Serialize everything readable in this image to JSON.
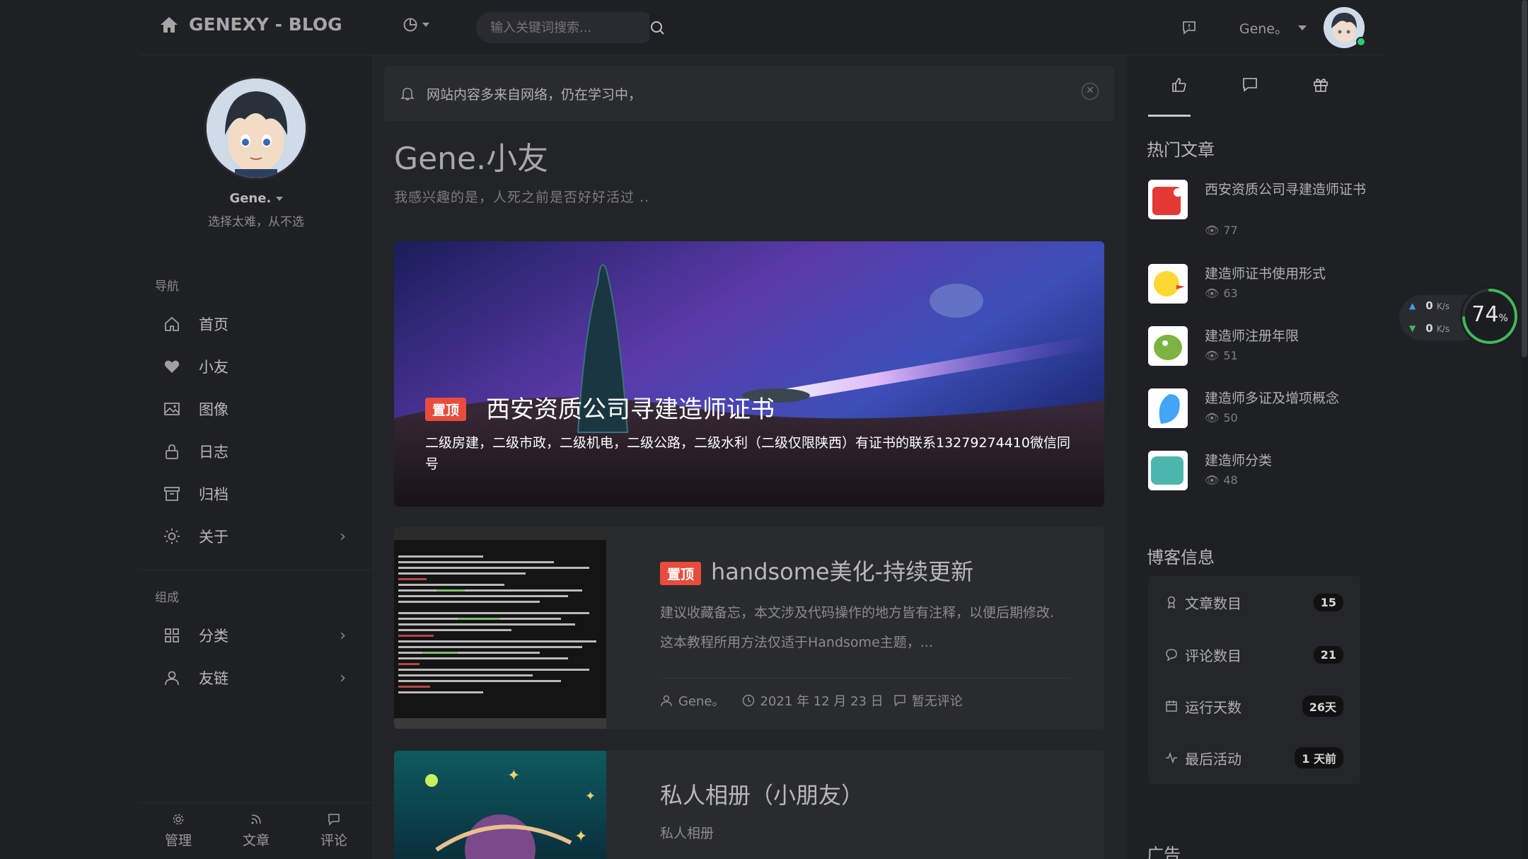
{
  "brand": {
    "title": "GENEXY - BLOG"
  },
  "search": {
    "placeholder": "输入关键词搜索..."
  },
  "user": {
    "name": "Gene。"
  },
  "profile": {
    "name": "Gene.",
    "bio": "选择太难，从不选"
  },
  "nav": {
    "section1": "导航",
    "items": [
      {
        "label": "首页",
        "icon": "home-icon"
      },
      {
        "label": "小友",
        "icon": "heart-icon"
      },
      {
        "label": "图像",
        "icon": "image-icon"
      },
      {
        "label": "日志",
        "icon": "lock-icon"
      },
      {
        "label": "归档",
        "icon": "archive-icon"
      },
      {
        "label": "关于",
        "icon": "sun-icon"
      }
    ],
    "section2": "组成",
    "items2": [
      {
        "label": "分类",
        "icon": "grid-icon"
      },
      {
        "label": "友链",
        "icon": "user-icon"
      }
    ]
  },
  "bottom": {
    "manage": "管理",
    "articles": "文章",
    "comments": "评论"
  },
  "notice": {
    "text": "网站内容多来自网络，仍在学习中，"
  },
  "headline": {
    "title": "Gene.小友",
    "subtitle": "我感兴趣的是，人死之前是否好好活过 .."
  },
  "hero": {
    "tag": "置顶",
    "title": "西安资质公司寻建造师证书",
    "desc": "二级房建，二级市政，二级机电，二级公路，二级水利（二级仅限陕西）有证书的联系13279274410微信同号"
  },
  "posts": [
    {
      "tag": "置顶",
      "title": "handsome美化-持续更新",
      "desc": "建议收藏备忘，本文涉及代码操作的地方皆有注释，以便后期修改.这本教程所用方法仅适于Handsome主题，...",
      "author": "Gene。",
      "date": "2021 年 12 月 23 日",
      "comments": "暂无评论"
    },
    {
      "title": "私人相册（小朋友）",
      "desc": "私人相册"
    }
  ],
  "right": {
    "popular_title": "热门文章",
    "popular": [
      {
        "title": "西安资质公司寻建造师证书",
        "views": "77",
        "color": "#e53935"
      },
      {
        "title": "建造师证书使用形式",
        "views": "63",
        "color": "#fdd835"
      },
      {
        "title": "建造师注册年限",
        "views": "51",
        "color": "#7cb342"
      },
      {
        "title": "建造师多证及增项概念",
        "views": "50",
        "color": "#42a5f5"
      },
      {
        "title": "建造师分类",
        "views": "48",
        "color": "#4db6ac"
      }
    ],
    "info_title": "博客信息",
    "info": [
      {
        "label": "文章数目",
        "value": "15"
      },
      {
        "label": "评论数目",
        "value": "21"
      },
      {
        "label": "运行天数",
        "value": "26天"
      },
      {
        "label": "最后活动",
        "value": "1 天前"
      }
    ],
    "ad_title": "广告"
  },
  "speed": {
    "up": "0",
    "down": "0",
    "unit": "K/s",
    "percent": "74",
    "percent_unit": "%"
  }
}
